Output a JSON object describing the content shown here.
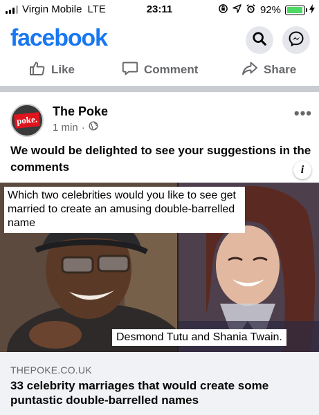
{
  "status_bar": {
    "carrier": "Virgin Mobile",
    "network": "LTE",
    "time": "23:11",
    "battery": "92%",
    "battery_level": 0.92
  },
  "header": {
    "logo": "facebook",
    "search_icon": "search-icon",
    "messenger_icon": "messenger-icon"
  },
  "actions": {
    "like": "Like",
    "comment": "Comment",
    "share": "Share"
  },
  "post": {
    "page_name": "The Poke",
    "avatar_text": "poke.",
    "time": "1 min",
    "separator": "·",
    "text": "We would be delighted to see your suggestions in the comments"
  },
  "image": {
    "caption_top": "Which two celebrities would you like to see get married to create an amusing double-barrelled name",
    "caption_bottom": "Desmond Tutu and Shania Twain.",
    "info": "i"
  },
  "link": {
    "domain": "THEPOKE.CO.UK",
    "title": "33 celebrity marriages that would create some puntastic double-barrelled names"
  },
  "colors": {
    "brand": "#1877f2",
    "secondary_text": "#65676b",
    "divider": "#c9ccd1",
    "battery": "#4cd964"
  }
}
